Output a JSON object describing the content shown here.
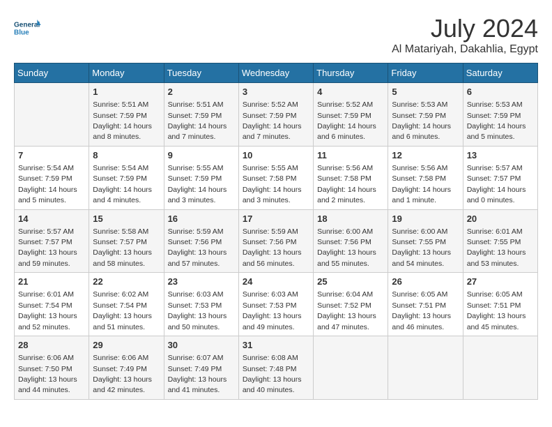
{
  "header": {
    "logo_line1": "General",
    "logo_line2": "Blue",
    "month_year": "July 2024",
    "location": "Al Matariyah, Dakahlia, Egypt"
  },
  "days_of_week": [
    "Sunday",
    "Monday",
    "Tuesday",
    "Wednesday",
    "Thursday",
    "Friday",
    "Saturday"
  ],
  "weeks": [
    [
      {
        "day": "",
        "info": ""
      },
      {
        "day": "1",
        "info": "Sunrise: 5:51 AM\nSunset: 7:59 PM\nDaylight: 14 hours\nand 8 minutes."
      },
      {
        "day": "2",
        "info": "Sunrise: 5:51 AM\nSunset: 7:59 PM\nDaylight: 14 hours\nand 7 minutes."
      },
      {
        "day": "3",
        "info": "Sunrise: 5:52 AM\nSunset: 7:59 PM\nDaylight: 14 hours\nand 7 minutes."
      },
      {
        "day": "4",
        "info": "Sunrise: 5:52 AM\nSunset: 7:59 PM\nDaylight: 14 hours\nand 6 minutes."
      },
      {
        "day": "5",
        "info": "Sunrise: 5:53 AM\nSunset: 7:59 PM\nDaylight: 14 hours\nand 6 minutes."
      },
      {
        "day": "6",
        "info": "Sunrise: 5:53 AM\nSunset: 7:59 PM\nDaylight: 14 hours\nand 5 minutes."
      }
    ],
    [
      {
        "day": "7",
        "info": "Sunrise: 5:54 AM\nSunset: 7:59 PM\nDaylight: 14 hours\nand 5 minutes."
      },
      {
        "day": "8",
        "info": "Sunrise: 5:54 AM\nSunset: 7:59 PM\nDaylight: 14 hours\nand 4 minutes."
      },
      {
        "day": "9",
        "info": "Sunrise: 5:55 AM\nSunset: 7:59 PM\nDaylight: 14 hours\nand 3 minutes."
      },
      {
        "day": "10",
        "info": "Sunrise: 5:55 AM\nSunset: 7:58 PM\nDaylight: 14 hours\nand 3 minutes."
      },
      {
        "day": "11",
        "info": "Sunrise: 5:56 AM\nSunset: 7:58 PM\nDaylight: 14 hours\nand 2 minutes."
      },
      {
        "day": "12",
        "info": "Sunrise: 5:56 AM\nSunset: 7:58 PM\nDaylight: 14 hours\nand 1 minute."
      },
      {
        "day": "13",
        "info": "Sunrise: 5:57 AM\nSunset: 7:57 PM\nDaylight: 14 hours\nand 0 minutes."
      }
    ],
    [
      {
        "day": "14",
        "info": "Sunrise: 5:57 AM\nSunset: 7:57 PM\nDaylight: 13 hours\nand 59 minutes."
      },
      {
        "day": "15",
        "info": "Sunrise: 5:58 AM\nSunset: 7:57 PM\nDaylight: 13 hours\nand 58 minutes."
      },
      {
        "day": "16",
        "info": "Sunrise: 5:59 AM\nSunset: 7:56 PM\nDaylight: 13 hours\nand 57 minutes."
      },
      {
        "day": "17",
        "info": "Sunrise: 5:59 AM\nSunset: 7:56 PM\nDaylight: 13 hours\nand 56 minutes."
      },
      {
        "day": "18",
        "info": "Sunrise: 6:00 AM\nSunset: 7:56 PM\nDaylight: 13 hours\nand 55 minutes."
      },
      {
        "day": "19",
        "info": "Sunrise: 6:00 AM\nSunset: 7:55 PM\nDaylight: 13 hours\nand 54 minutes."
      },
      {
        "day": "20",
        "info": "Sunrise: 6:01 AM\nSunset: 7:55 PM\nDaylight: 13 hours\nand 53 minutes."
      }
    ],
    [
      {
        "day": "21",
        "info": "Sunrise: 6:01 AM\nSunset: 7:54 PM\nDaylight: 13 hours\nand 52 minutes."
      },
      {
        "day": "22",
        "info": "Sunrise: 6:02 AM\nSunset: 7:54 PM\nDaylight: 13 hours\nand 51 minutes."
      },
      {
        "day": "23",
        "info": "Sunrise: 6:03 AM\nSunset: 7:53 PM\nDaylight: 13 hours\nand 50 minutes."
      },
      {
        "day": "24",
        "info": "Sunrise: 6:03 AM\nSunset: 7:53 PM\nDaylight: 13 hours\nand 49 minutes."
      },
      {
        "day": "25",
        "info": "Sunrise: 6:04 AM\nSunset: 7:52 PM\nDaylight: 13 hours\nand 47 minutes."
      },
      {
        "day": "26",
        "info": "Sunrise: 6:05 AM\nSunset: 7:51 PM\nDaylight: 13 hours\nand 46 minutes."
      },
      {
        "day": "27",
        "info": "Sunrise: 6:05 AM\nSunset: 7:51 PM\nDaylight: 13 hours\nand 45 minutes."
      }
    ],
    [
      {
        "day": "28",
        "info": "Sunrise: 6:06 AM\nSunset: 7:50 PM\nDaylight: 13 hours\nand 44 minutes."
      },
      {
        "day": "29",
        "info": "Sunrise: 6:06 AM\nSunset: 7:49 PM\nDaylight: 13 hours\nand 42 minutes."
      },
      {
        "day": "30",
        "info": "Sunrise: 6:07 AM\nSunset: 7:49 PM\nDaylight: 13 hours\nand 41 minutes."
      },
      {
        "day": "31",
        "info": "Sunrise: 6:08 AM\nSunset: 7:48 PM\nDaylight: 13 hours\nand 40 minutes."
      },
      {
        "day": "",
        "info": ""
      },
      {
        "day": "",
        "info": ""
      },
      {
        "day": "",
        "info": ""
      }
    ]
  ]
}
